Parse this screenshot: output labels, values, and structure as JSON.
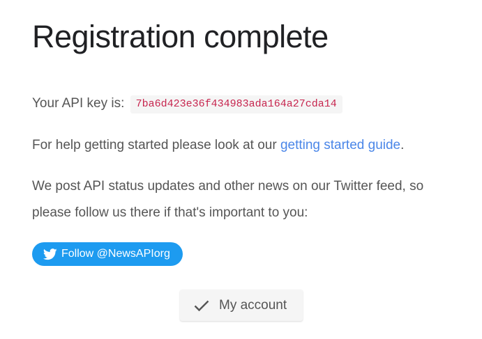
{
  "page": {
    "title": "Registration complete"
  },
  "api_key": {
    "label": "Your API key is:",
    "value": "7ba6d423e36f434983ada164a27cda14"
  },
  "help": {
    "prefix": "For help getting started please look at our ",
    "link_text": "getting started guide",
    "suffix": "."
  },
  "news": {
    "line1": "We post API status updates and other news on our Twitter feed, so",
    "line2": "please follow us there if that's important to you:"
  },
  "twitter_button": {
    "label": "Follow @NewsAPIorg",
    "icon": "twitter-bird-icon",
    "color": "#1d9bf0"
  },
  "account_button": {
    "label": "My account",
    "icon": "checkmark-icon"
  },
  "colors": {
    "link": "#4a86e8",
    "code_text": "#c7254e",
    "code_bg": "#f5f5f5"
  }
}
